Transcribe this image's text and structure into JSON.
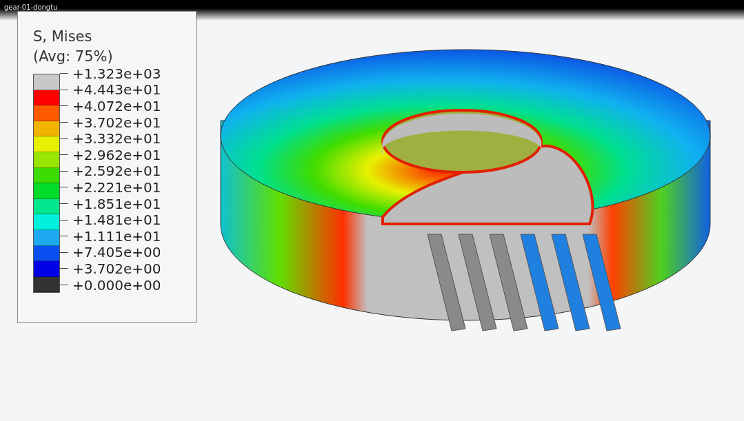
{
  "window": {
    "title": "gear-01-dongtu"
  },
  "legend": {
    "title": "S, Mises",
    "subtitle": "(Avg: 75%)",
    "bands": [
      {
        "color": "#c8c8c8"
      },
      {
        "color": "#ff0000"
      },
      {
        "color": "#ff5a00"
      },
      {
        "color": "#f0b400"
      },
      {
        "color": "#e6f000"
      },
      {
        "color": "#96e600"
      },
      {
        "color": "#3cdc00"
      },
      {
        "color": "#00dc28"
      },
      {
        "color": "#00e68c"
      },
      {
        "color": "#00f0dc"
      },
      {
        "color": "#1eaaf0"
      },
      {
        "color": "#0a50f0"
      },
      {
        "color": "#0000e6"
      },
      {
        "color": "#323232"
      }
    ],
    "ticks": [
      "+1.323e+03",
      "+4.443e+01",
      "+4.072e+01",
      "+3.702e+01",
      "+3.332e+01",
      "+2.962e+01",
      "+2.592e+01",
      "+2.221e+01",
      "+1.851e+01",
      "+1.481e+01",
      "+1.111e+01",
      "+7.405e+00",
      "+3.702e+00",
      "+0.000e+00"
    ]
  }
}
